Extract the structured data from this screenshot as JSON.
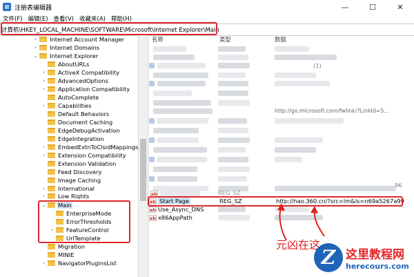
{
  "window": {
    "title": "注册表编辑器",
    "controls": [
      "—",
      "☐",
      "✕"
    ]
  },
  "menu": [
    "文件(F)",
    "编辑(E)",
    "查看(V)",
    "收藏夹(A)",
    "帮助(H)"
  ],
  "address": "计算机\\HKEY_LOCAL_MACHINE\\SOFTWARE\\Microsoft\\Internet Explorer\\Main",
  "tree": [
    {
      "label": "Internet Account Manager",
      "caret": "›"
    },
    {
      "label": "Internet Domains",
      "caret": "›"
    },
    {
      "label": "Internet Explorer",
      "caret": "⌄"
    },
    {
      "label": "AboutURLs",
      "caret": ""
    },
    {
      "label": "ActiveX Compatibility",
      "caret": "›"
    },
    {
      "label": "AdvancedOptions",
      "caret": "›"
    },
    {
      "label": "Application Compatibility",
      "caret": "›"
    },
    {
      "label": "AutoComplete",
      "caret": ""
    },
    {
      "label": "Capabilities",
      "caret": "›"
    },
    {
      "label": "Default Behaviors",
      "caret": ""
    },
    {
      "label": "Document Caching",
      "caret": ""
    },
    {
      "label": "EdgeDebugActivation",
      "caret": ""
    },
    {
      "label": "EdgeIntegration",
      "caret": ""
    },
    {
      "label": "EmbedExtnToClsidMappings",
      "caret": "›"
    },
    {
      "label": "Extension Compatibility",
      "caret": "›"
    },
    {
      "label": "Extension Validation",
      "caret": ""
    },
    {
      "label": "Feed Discovery",
      "caret": ""
    },
    {
      "label": "Image Caching",
      "caret": ""
    },
    {
      "label": "International",
      "caret": "›"
    },
    {
      "label": "Low Rights",
      "caret": "›"
    },
    {
      "label": "Main",
      "caret": "⌄"
    },
    {
      "label": "EnterpriseMode",
      "caret": ""
    },
    {
      "label": "ErrorThresholds",
      "caret": ""
    },
    {
      "label": "FeatureControl",
      "caret": "›"
    },
    {
      "label": "UrlTemplate",
      "caret": ""
    },
    {
      "label": "Migration",
      "caret": ""
    },
    {
      "label": "MINIE",
      "caret": ""
    },
    {
      "label": "NavigatorPluginsList",
      "caret": "›"
    }
  ],
  "columns": {
    "name": "名称",
    "type": "类型",
    "data": "数据"
  },
  "partial": {
    "url_fragment": "http://go.microsoft.com/fwlink/?LinkId=5...",
    "digits_a": "(1)",
    "digits_b": "96",
    "type_a": "REG_SZ"
  },
  "values": [
    {
      "name": "Start Page",
      "type": "REG_SZ",
      "data": "http://hao.360.cn/?src=lm&ls=n69a5267a99",
      "icon": "ab"
    },
    {
      "name": "Use_Async_DNS",
      "type": "",
      "data": "",
      "icon": "ab"
    },
    {
      "name": "x86AppPath",
      "type": "",
      "data": "",
      "icon": "ab"
    }
  ],
  "annotation": "元凶在这",
  "watermark": {
    "title": "这里教程网",
    "url": "herecours.com",
    "logo": "Z"
  },
  "colors": {
    "highlight": "#e0262a",
    "selection": "#cce4f7"
  }
}
